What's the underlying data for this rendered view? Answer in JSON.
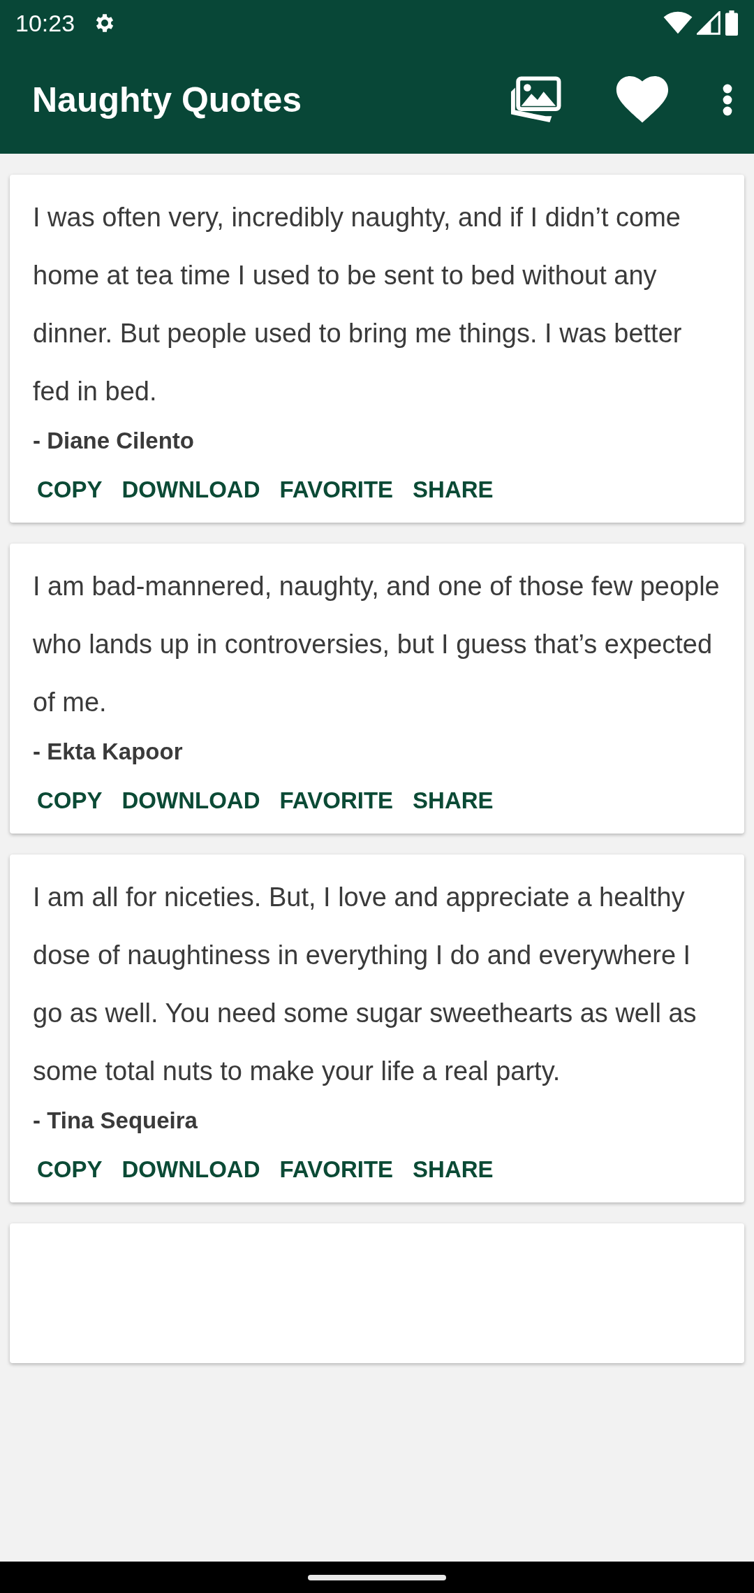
{
  "status_bar": {
    "time": "10:23"
  },
  "app_bar": {
    "title": "Naughty Quotes"
  },
  "quotes": [
    {
      "text": "I was often very, incredibly naughty, and if I didn’t come home at tea time I used to be sent to bed without any dinner. But people used to bring me things. I was better fed in bed.",
      "author": "- Diane Cilento",
      "actions": [
        "COPY",
        "DOWNLOAD",
        "FAVORITE",
        "SHARE"
      ]
    },
    {
      "text": "I am bad-mannered, naughty, and one of those few people who lands up in controversies, but I guess that’s expected of me.",
      "author": "- Ekta Kapoor",
      "actions": [
        "COPY",
        "DOWNLOAD",
        "FAVORITE",
        "SHARE"
      ]
    },
    {
      "text": "I am all for niceties. But, I love and appreciate a healthy dose of naughtiness in everything I do and everywhere I go as well. You need some sugar sweethearts as well as some total nuts to make your life a real party.",
      "author": "- Tina Sequeira",
      "actions": [
        "COPY",
        "DOWNLOAD",
        "FAVORITE",
        "SHARE"
      ]
    }
  ]
}
